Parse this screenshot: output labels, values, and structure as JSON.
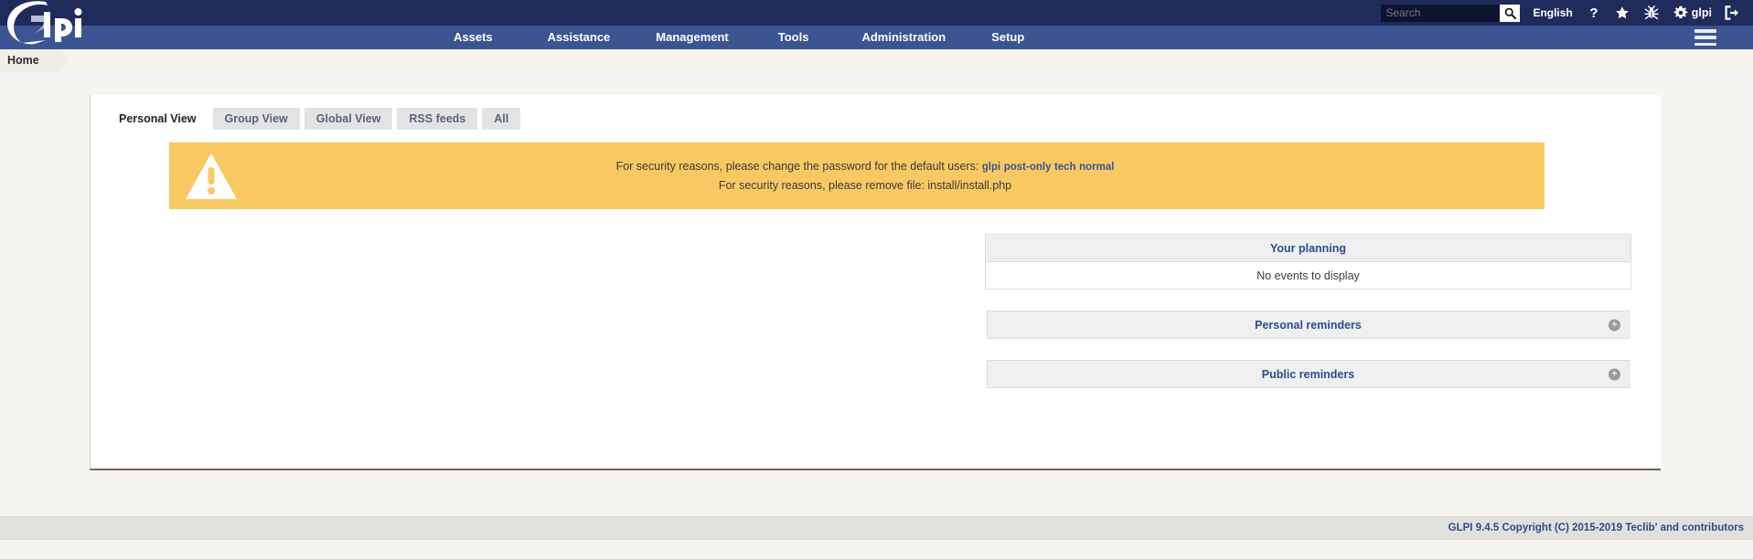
{
  "header": {
    "logo_text": "Glpi",
    "search": {
      "placeholder": "Search",
      "value": ""
    },
    "search_icon": "search-icon",
    "language": "English",
    "icons": [
      {
        "name": "help-icon",
        "glyph": "?"
      },
      {
        "name": "bookmark-star-icon",
        "glyph": "★"
      },
      {
        "name": "debug-bug-icon",
        "glyph": "🐞"
      },
      {
        "name": "preferences-gear-icon",
        "glyph": "⚙"
      }
    ],
    "user": "glpi",
    "logout_icon": "logout-icon"
  },
  "nav": {
    "items": [
      {
        "label": "Assets"
      },
      {
        "label": "Assistance"
      },
      {
        "label": "Management"
      },
      {
        "label": "Tools"
      },
      {
        "label": "Administration"
      },
      {
        "label": "Setup"
      }
    ],
    "menu_icon": "hamburger-menu-icon"
  },
  "breadcrumb": {
    "current": "Home"
  },
  "tabs": [
    {
      "label": "Personal View",
      "active": true
    },
    {
      "label": "Group View",
      "active": false
    },
    {
      "label": "Global View",
      "active": false
    },
    {
      "label": "RSS feeds",
      "active": false
    },
    {
      "label": "All",
      "active": false
    }
  ],
  "warning": {
    "icon": "warning-triangle-icon",
    "line1_prefix": "For security reasons, please change the password for the default users: ",
    "line1_links": [
      "glpi",
      "post-only",
      "tech",
      "normal"
    ],
    "line2": "For security reasons, please remove file: install/install.php",
    "bg_color": "#f8c963"
  },
  "widgets": [
    {
      "name": "your-planning",
      "title": "Your planning",
      "body": "No events to display",
      "has_body": true,
      "has_add": false
    },
    {
      "name": "personal-reminders",
      "title": "Personal reminders",
      "body": "",
      "has_body": false,
      "has_add": true,
      "add_label": "+"
    },
    {
      "name": "public-reminders",
      "title": "Public reminders",
      "body": "",
      "has_body": false,
      "has_add": true,
      "add_label": "+"
    }
  ],
  "footer": {
    "text": "GLPI 9.4.5 Copyright (C) 2015-2019 Teclib' and contributors"
  },
  "colors": {
    "header_dark": "#1f2b5b",
    "nav_blue": "#3a5591",
    "page_bg": "#f7f5f1",
    "accent_link": "#2d4b8e",
    "warning": "#f8c963"
  }
}
